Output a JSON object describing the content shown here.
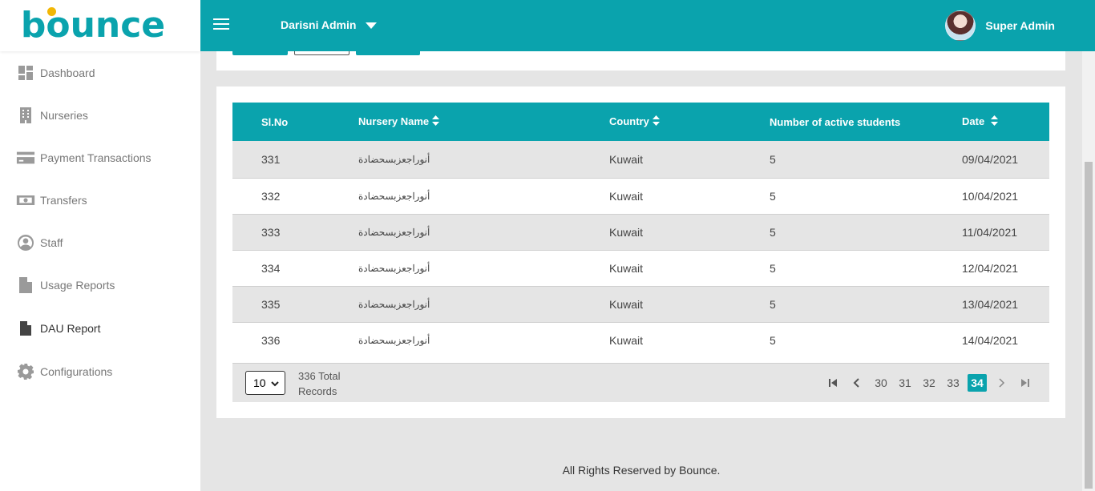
{
  "brand": {
    "logo_text": "bounce",
    "accent_color": "#0aa3ad",
    "logo_dot_color": "#f2b705"
  },
  "sidebar": {
    "items": [
      {
        "label": "Dashboard",
        "icon": "dashboard-icon"
      },
      {
        "label": "Nurseries",
        "icon": "building-icon"
      },
      {
        "label": "Payment Transactions",
        "icon": "credit-card-icon"
      },
      {
        "label": "Transfers",
        "icon": "money-bill-icon"
      },
      {
        "label": "Staff",
        "icon": "user-circle-icon"
      },
      {
        "label": "Usage Reports",
        "icon": "file-icon"
      },
      {
        "label": "DAU Report",
        "icon": "file-icon",
        "active": true
      },
      {
        "label": "Configurations",
        "icon": "gear-icon"
      }
    ]
  },
  "header": {
    "workspace": "Darisni Admin",
    "user_name": "Super Admin"
  },
  "table": {
    "columns": [
      "Sl.No",
      "Nursery Name",
      "Country",
      "Number of active students",
      "Date"
    ],
    "rows": [
      {
        "sl": "331",
        "name": "أنوراجعزبسحضادة",
        "country": "Kuwait",
        "students": "5",
        "date": "09/04/2021"
      },
      {
        "sl": "332",
        "name": "أنوراجعزبسحضادة",
        "country": "Kuwait",
        "students": "5",
        "date": "10/04/2021"
      },
      {
        "sl": "333",
        "name": "أنوراجعزبسحضادة",
        "country": "Kuwait",
        "students": "5",
        "date": "11/04/2021"
      },
      {
        "sl": "334",
        "name": "أنوراجعزبسحضادة",
        "country": "Kuwait",
        "students": "5",
        "date": "12/04/2021"
      },
      {
        "sl": "335",
        "name": "أنوراجعزبسحضادة",
        "country": "Kuwait",
        "students": "5",
        "date": "13/04/2021"
      },
      {
        "sl": "336",
        "name": "أنوراجعزبسحضادة",
        "country": "Kuwait",
        "students": "5",
        "date": "14/04/2021"
      }
    ]
  },
  "pagination": {
    "page_size": "10",
    "total_line1": "336 Total",
    "total_line2": "Records",
    "pages": [
      "30",
      "31",
      "32",
      "33",
      "34"
    ],
    "current": "34"
  },
  "footer": {
    "text": "All Rights Reserved by Bounce."
  }
}
